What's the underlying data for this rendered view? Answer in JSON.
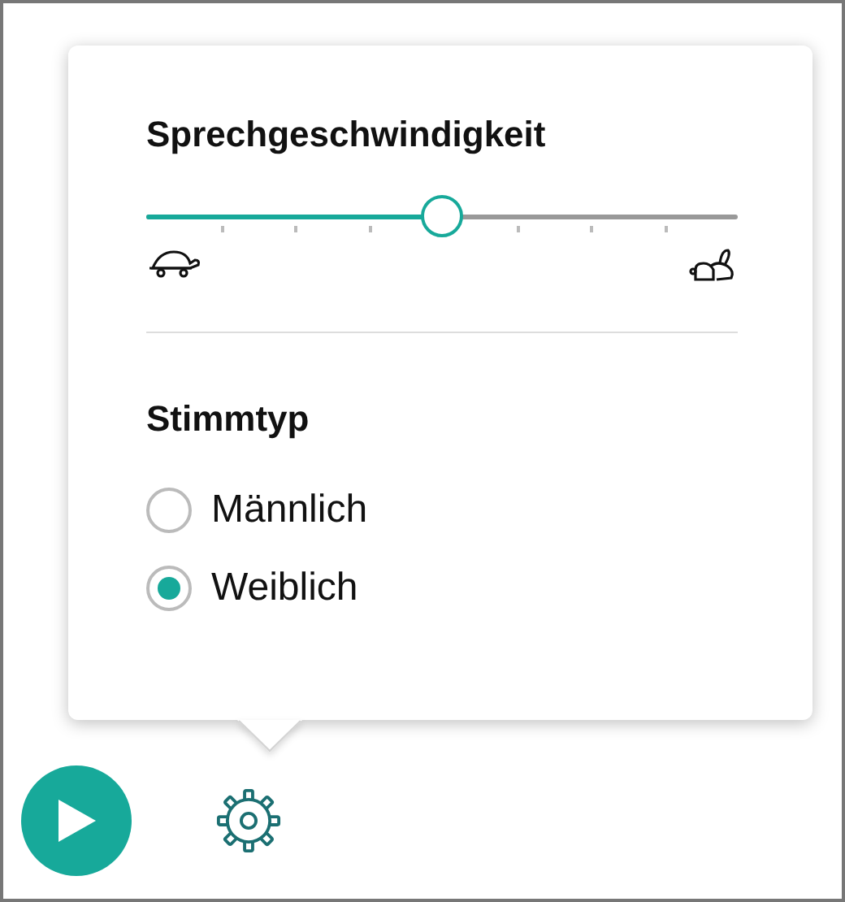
{
  "speed": {
    "title": "Sprechgeschwindigkeit",
    "level": 0.5
  },
  "voice": {
    "title": "Stimmtyp",
    "options": [
      {
        "label": "Männlich",
        "selected": false
      },
      {
        "label": "Weiblich",
        "selected": true
      }
    ]
  }
}
